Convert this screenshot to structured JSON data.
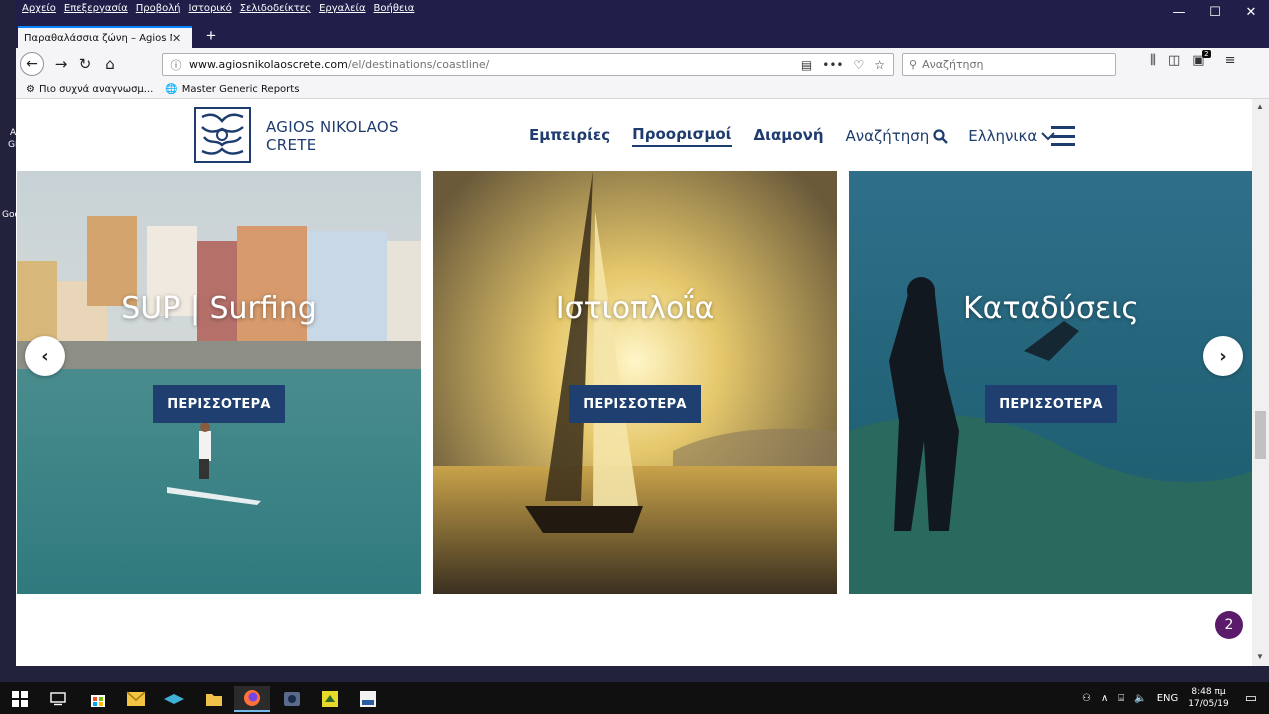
{
  "desktop": {
    "labels": [
      "A",
      "GF",
      "Goo"
    ]
  },
  "browser": {
    "menu": [
      "Αρχείο",
      "Επεξεργασία",
      "Προβολή",
      "Ιστορικό",
      "Σελιδοδείκτες",
      "Εργαλεία",
      "Βοήθεια"
    ],
    "window_controls": [
      "—",
      "☐",
      "✕"
    ],
    "tab": {
      "title": "Παραθαλάσσια ζώνη – Agios Nikol",
      "close": "✕"
    },
    "new_tab": "+",
    "url": {
      "host": "www.agiosnikolaoscrete.com",
      "path": "/el/destinations/coastline/"
    },
    "search_placeholder": "Αναζήτηση",
    "toolbar_badge": "2",
    "bookmarks": [
      "Πιο συχνά αναγνωσμ...",
      "Master Generic Reports"
    ]
  },
  "site": {
    "logo_line1": "AGIOS NIKOLAOS",
    "logo_line2": "CRETE",
    "nav": [
      {
        "label": "Εμπειρίες",
        "active": false
      },
      {
        "label": "Προορισμοί",
        "active": true
      },
      {
        "label": "Διαμονή",
        "active": false
      }
    ],
    "search_label": "Αναζήτηση",
    "language": "Ελληνικα",
    "cards": [
      {
        "title": "SUP | Surfing",
        "button": "ΠΕΡΙΣΣΟΤΕΡΑ"
      },
      {
        "title": "Ιστιοπλοΐα",
        "button": "ΠΕΡΙΣΣΟΤΕΡΑ"
      },
      {
        "title": "Καταδύσεις",
        "button": "ΠΕΡΙΣΣΟΤΕΡΑ"
      }
    ],
    "prev_arrow": "‹",
    "next_arrow": "›",
    "notification_count": "2"
  },
  "taskbar": {
    "language": "ENG",
    "time": "8:48 πμ",
    "date": "17/05/19"
  }
}
